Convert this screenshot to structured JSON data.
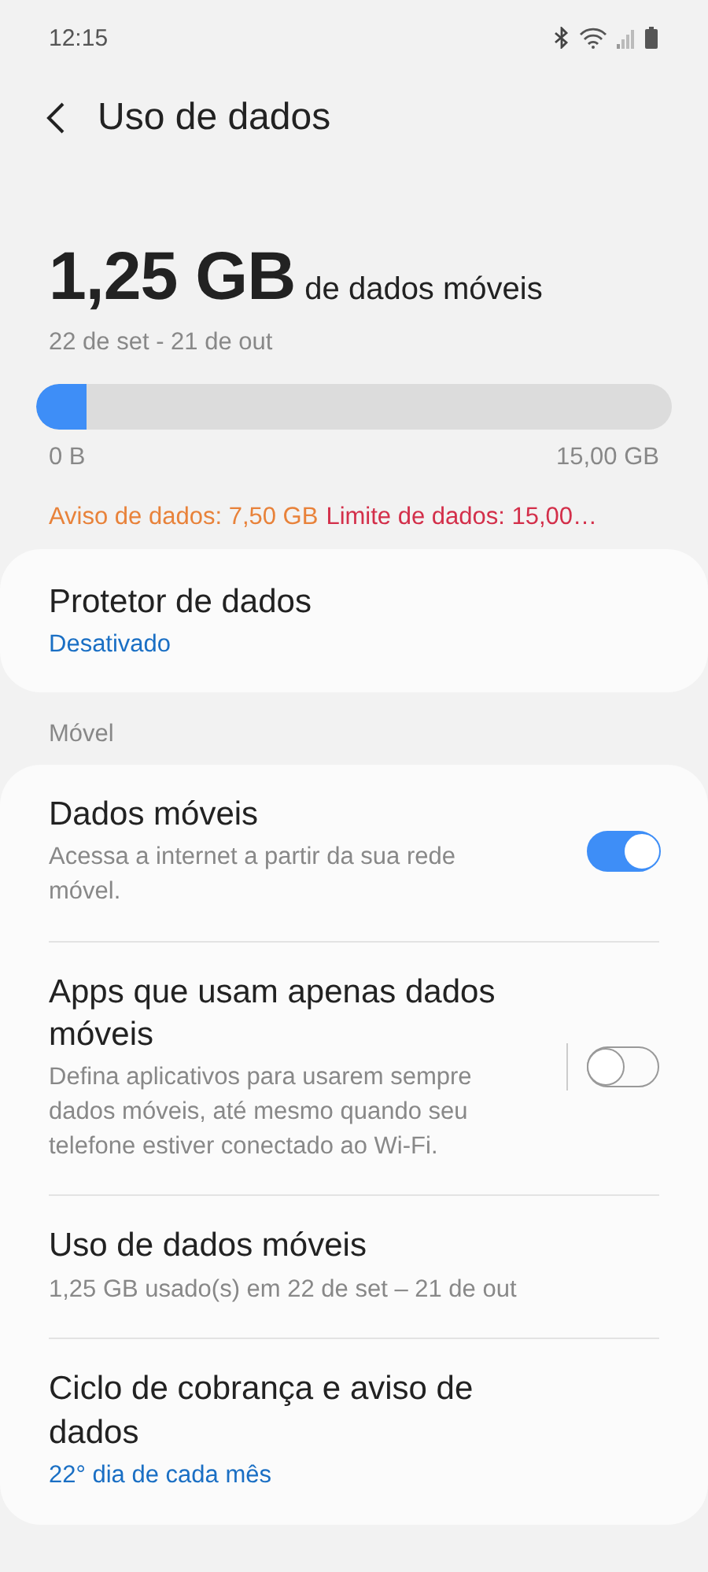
{
  "status_bar": {
    "time": "12:15"
  },
  "header": {
    "title": "Uso de dados"
  },
  "usage": {
    "amount": "1,25 GB",
    "unit_label": "de dados móveis",
    "period": "22 de set - 21 de out",
    "level": 0.08,
    "min_label": "0 B",
    "max_label": "15,00 GB",
    "warning": "Aviso de dados: 7,50 GB",
    "limit": "Limite de dados: 15,00…"
  },
  "saver_card": {
    "title": "Protetor de dados",
    "subtitle": "Desativado",
    "highlighted": true
  },
  "section_header": "Móvel",
  "mobile_items": [
    {
      "kind": "toggle",
      "title": "Dados móveis",
      "subtitle": "Acessa a internet a partir da sua rede móvel.",
      "highlighted": false,
      "on": true,
      "separated": false
    },
    {
      "kind": "toggle",
      "title": "Apps que usam apenas dados móveis",
      "subtitle": "Defina aplicativos para usarem sempre dados móveis, até mesmo quando seu telefone estiver conectado ao Wi-Fi.",
      "highlighted": false,
      "on": false,
      "separated": true
    },
    {
      "kind": "plain",
      "title": "Uso de dados móveis",
      "subtitle": "1,25 GB usado(s) em 22 de set – 21 de out",
      "highlighted": false
    },
    {
      "kind": "plain",
      "title": "Ciclo de cobrança e aviso de dados",
      "subtitle": "22° dia de cada mês",
      "highlighted": true
    }
  ]
}
